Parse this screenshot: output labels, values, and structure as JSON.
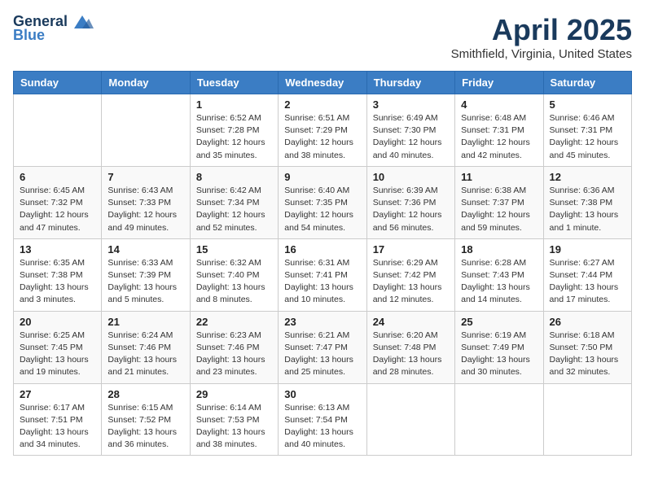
{
  "header": {
    "logo_line1": "General",
    "logo_line2": "Blue",
    "title": "April 2025",
    "subtitle": "Smithfield, Virginia, United States"
  },
  "days_of_week": [
    "Sunday",
    "Monday",
    "Tuesday",
    "Wednesday",
    "Thursday",
    "Friday",
    "Saturday"
  ],
  "weeks": [
    [
      {
        "day": null
      },
      {
        "day": null
      },
      {
        "day": "1",
        "sunrise": "Sunrise: 6:52 AM",
        "sunset": "Sunset: 7:28 PM",
        "daylight": "Daylight: 12 hours and 35 minutes."
      },
      {
        "day": "2",
        "sunrise": "Sunrise: 6:51 AM",
        "sunset": "Sunset: 7:29 PM",
        "daylight": "Daylight: 12 hours and 38 minutes."
      },
      {
        "day": "3",
        "sunrise": "Sunrise: 6:49 AM",
        "sunset": "Sunset: 7:30 PM",
        "daylight": "Daylight: 12 hours and 40 minutes."
      },
      {
        "day": "4",
        "sunrise": "Sunrise: 6:48 AM",
        "sunset": "Sunset: 7:31 PM",
        "daylight": "Daylight: 12 hours and 42 minutes."
      },
      {
        "day": "5",
        "sunrise": "Sunrise: 6:46 AM",
        "sunset": "Sunset: 7:31 PM",
        "daylight": "Daylight: 12 hours and 45 minutes."
      }
    ],
    [
      {
        "day": "6",
        "sunrise": "Sunrise: 6:45 AM",
        "sunset": "Sunset: 7:32 PM",
        "daylight": "Daylight: 12 hours and 47 minutes."
      },
      {
        "day": "7",
        "sunrise": "Sunrise: 6:43 AM",
        "sunset": "Sunset: 7:33 PM",
        "daylight": "Daylight: 12 hours and 49 minutes."
      },
      {
        "day": "8",
        "sunrise": "Sunrise: 6:42 AM",
        "sunset": "Sunset: 7:34 PM",
        "daylight": "Daylight: 12 hours and 52 minutes."
      },
      {
        "day": "9",
        "sunrise": "Sunrise: 6:40 AM",
        "sunset": "Sunset: 7:35 PM",
        "daylight": "Daylight: 12 hours and 54 minutes."
      },
      {
        "day": "10",
        "sunrise": "Sunrise: 6:39 AM",
        "sunset": "Sunset: 7:36 PM",
        "daylight": "Daylight: 12 hours and 56 minutes."
      },
      {
        "day": "11",
        "sunrise": "Sunrise: 6:38 AM",
        "sunset": "Sunset: 7:37 PM",
        "daylight": "Daylight: 12 hours and 59 minutes."
      },
      {
        "day": "12",
        "sunrise": "Sunrise: 6:36 AM",
        "sunset": "Sunset: 7:38 PM",
        "daylight": "Daylight: 13 hours and 1 minute."
      }
    ],
    [
      {
        "day": "13",
        "sunrise": "Sunrise: 6:35 AM",
        "sunset": "Sunset: 7:38 PM",
        "daylight": "Daylight: 13 hours and 3 minutes."
      },
      {
        "day": "14",
        "sunrise": "Sunrise: 6:33 AM",
        "sunset": "Sunset: 7:39 PM",
        "daylight": "Daylight: 13 hours and 5 minutes."
      },
      {
        "day": "15",
        "sunrise": "Sunrise: 6:32 AM",
        "sunset": "Sunset: 7:40 PM",
        "daylight": "Daylight: 13 hours and 8 minutes."
      },
      {
        "day": "16",
        "sunrise": "Sunrise: 6:31 AM",
        "sunset": "Sunset: 7:41 PM",
        "daylight": "Daylight: 13 hours and 10 minutes."
      },
      {
        "day": "17",
        "sunrise": "Sunrise: 6:29 AM",
        "sunset": "Sunset: 7:42 PM",
        "daylight": "Daylight: 13 hours and 12 minutes."
      },
      {
        "day": "18",
        "sunrise": "Sunrise: 6:28 AM",
        "sunset": "Sunset: 7:43 PM",
        "daylight": "Daylight: 13 hours and 14 minutes."
      },
      {
        "day": "19",
        "sunrise": "Sunrise: 6:27 AM",
        "sunset": "Sunset: 7:44 PM",
        "daylight": "Daylight: 13 hours and 17 minutes."
      }
    ],
    [
      {
        "day": "20",
        "sunrise": "Sunrise: 6:25 AM",
        "sunset": "Sunset: 7:45 PM",
        "daylight": "Daylight: 13 hours and 19 minutes."
      },
      {
        "day": "21",
        "sunrise": "Sunrise: 6:24 AM",
        "sunset": "Sunset: 7:46 PM",
        "daylight": "Daylight: 13 hours and 21 minutes."
      },
      {
        "day": "22",
        "sunrise": "Sunrise: 6:23 AM",
        "sunset": "Sunset: 7:46 PM",
        "daylight": "Daylight: 13 hours and 23 minutes."
      },
      {
        "day": "23",
        "sunrise": "Sunrise: 6:21 AM",
        "sunset": "Sunset: 7:47 PM",
        "daylight": "Daylight: 13 hours and 25 minutes."
      },
      {
        "day": "24",
        "sunrise": "Sunrise: 6:20 AM",
        "sunset": "Sunset: 7:48 PM",
        "daylight": "Daylight: 13 hours and 28 minutes."
      },
      {
        "day": "25",
        "sunrise": "Sunrise: 6:19 AM",
        "sunset": "Sunset: 7:49 PM",
        "daylight": "Daylight: 13 hours and 30 minutes."
      },
      {
        "day": "26",
        "sunrise": "Sunrise: 6:18 AM",
        "sunset": "Sunset: 7:50 PM",
        "daylight": "Daylight: 13 hours and 32 minutes."
      }
    ],
    [
      {
        "day": "27",
        "sunrise": "Sunrise: 6:17 AM",
        "sunset": "Sunset: 7:51 PM",
        "daylight": "Daylight: 13 hours and 34 minutes."
      },
      {
        "day": "28",
        "sunrise": "Sunrise: 6:15 AM",
        "sunset": "Sunset: 7:52 PM",
        "daylight": "Daylight: 13 hours and 36 minutes."
      },
      {
        "day": "29",
        "sunrise": "Sunrise: 6:14 AM",
        "sunset": "Sunset: 7:53 PM",
        "daylight": "Daylight: 13 hours and 38 minutes."
      },
      {
        "day": "30",
        "sunrise": "Sunrise: 6:13 AM",
        "sunset": "Sunset: 7:54 PM",
        "daylight": "Daylight: 13 hours and 40 minutes."
      },
      {
        "day": null
      },
      {
        "day": null
      },
      {
        "day": null
      }
    ]
  ]
}
